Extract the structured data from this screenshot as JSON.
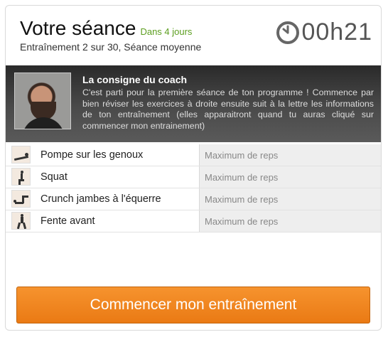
{
  "header": {
    "title": "Votre séance",
    "when": "Dans 4 jours",
    "subtitle": "Entraînement 2 sur 30, Séance moyenne",
    "timer": "00h21"
  },
  "coach": {
    "title": "La consigne du coach",
    "text": "C'est parti pour la première séance de ton programme ! Commence par bien réviser les exercices à droite ensuite suit à la lettre les informations de ton entraînement (elles apparaitront quand tu auras cliqué sur commencer mon entrainement)"
  },
  "exercises": [
    {
      "name": "Pompe sur les genoux",
      "reps": "Maximum de reps"
    },
    {
      "name": "Squat",
      "reps": "Maximum de reps"
    },
    {
      "name": "Crunch jambes à l'équerre",
      "reps": "Maximum de reps"
    },
    {
      "name": "Fente avant",
      "reps": "Maximum de reps"
    }
  ],
  "start_button": "Commencer mon entraînement",
  "colors": {
    "accent": "#ee8420",
    "when": "#5c9e1f",
    "coach_bg": "#3a3a3a"
  }
}
